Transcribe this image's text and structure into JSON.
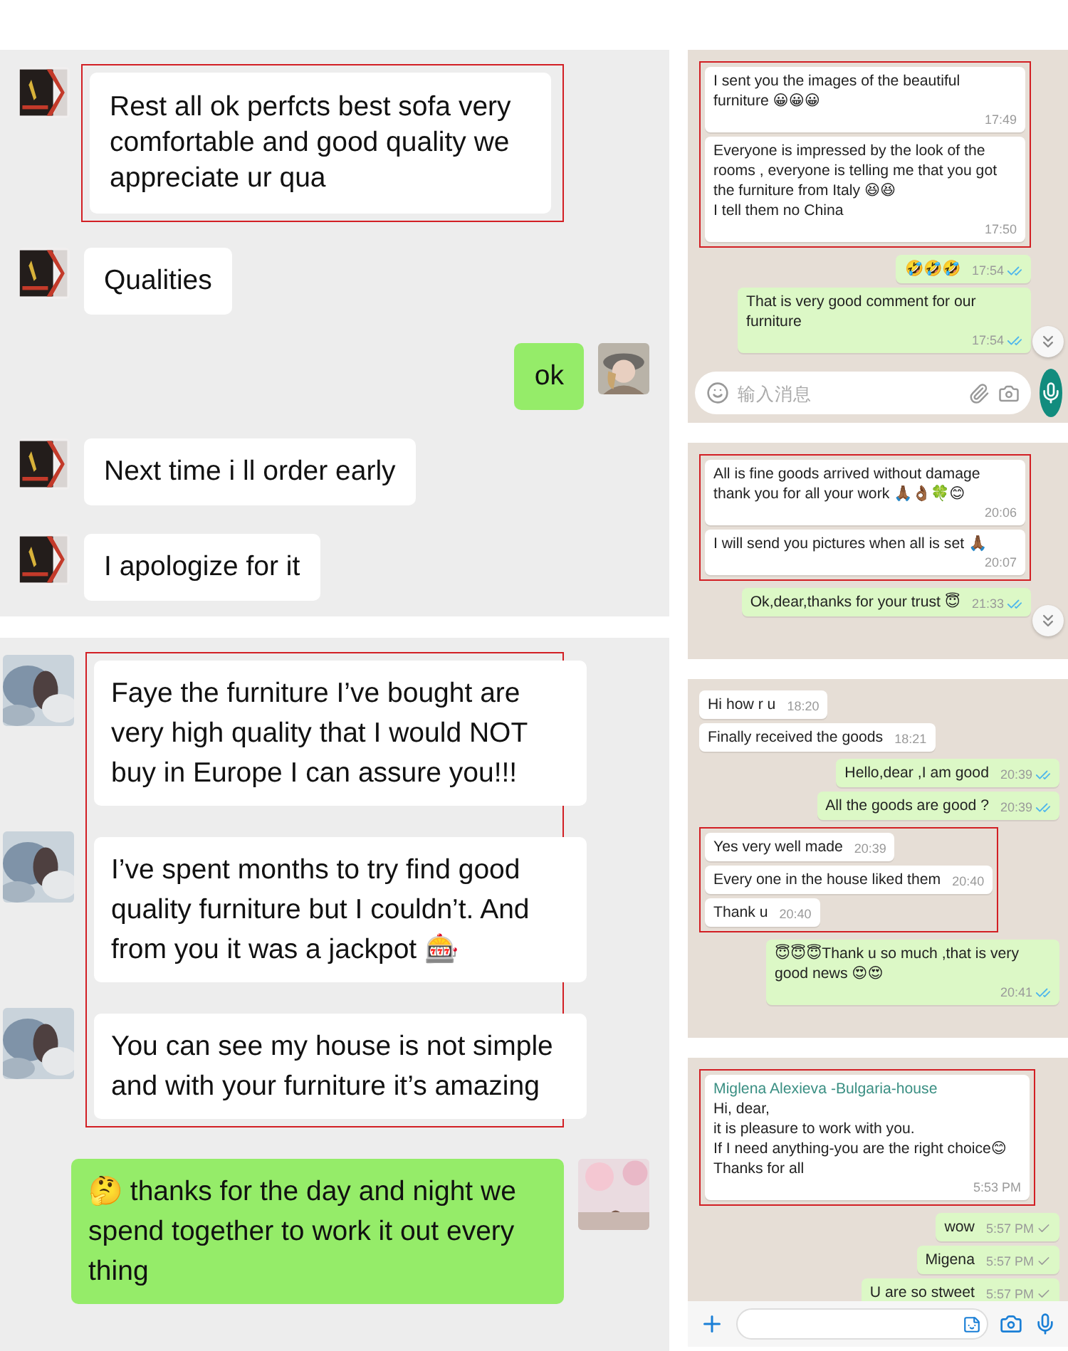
{
  "left_panels": [
    {
      "kind": "wechat",
      "groups": [
        {
          "outgoing": false,
          "highlighted": true,
          "messages": [
            {
              "text": "Rest all ok perfcts best sofa very comfortable and good quality we appreciate ur qua"
            }
          ]
        },
        {
          "outgoing": false,
          "highlighted": false,
          "messages": [
            {
              "text": "Qualities"
            }
          ]
        },
        {
          "outgoing": true,
          "highlighted": false,
          "messages": [
            {
              "text": "ok"
            }
          ]
        },
        {
          "outgoing": false,
          "highlighted": false,
          "messages": [
            {
              "text": "Next time i ll order early"
            }
          ]
        },
        {
          "outgoing": false,
          "highlighted": false,
          "messages": [
            {
              "text": "I apologize for it"
            }
          ]
        }
      ]
    },
    {
      "kind": "wechat_large",
      "groups": [
        {
          "outgoing": false,
          "highlighted": true,
          "messages": [
            {
              "text": "Faye the furniture I’ve bought are very high quality that I would NOT buy in Europe I can assure you!!!"
            },
            {
              "text": "I’ve spent months to try find good quality furniture but I couldn’t. And from you it was a jackpot 🎰"
            },
            {
              "text": "You can see my house is not simple and with your furniture it’s amazing"
            }
          ]
        },
        {
          "outgoing": true,
          "highlighted": false,
          "messages": [
            {
              "text": "🤔 thanks for the day and night we spend together to work it out every thing"
            }
          ]
        }
      ]
    }
  ],
  "right_panels": [
    {
      "kind": "whatsapp",
      "scroll_button": true,
      "groups": [
        {
          "outgoing": false,
          "highlighted": true,
          "messages": [
            {
              "text": "I sent you the images of the beautiful furniture 😀😀😀",
              "time": "17:49"
            },
            {
              "text": "Everyone is impressed by the look of the rooms , everyone is telling me that you got the furniture from Italy 😆😆\nI tell them no China",
              "time": "17:50"
            }
          ]
        },
        {
          "outgoing": true,
          "highlighted": false,
          "messages": [
            {
              "text": "🤣🤣🤣",
              "time": "17:54",
              "read": true
            },
            {
              "text": "That is very good comment for our furniture",
              "time": "17:54",
              "read": true
            }
          ]
        }
      ],
      "input": {
        "kind": "android",
        "placeholder": "输入消息"
      }
    },
    {
      "kind": "whatsapp",
      "scroll_button": true,
      "groups": [
        {
          "outgoing": false,
          "highlighted": true,
          "messages": [
            {
              "text": "All is fine goods arrived without damage thank you for all your work 🙏🏾👌🏾🍀😊",
              "time": "20:06"
            },
            {
              "text": "I will send you pictures when all is set 🙏🏾",
              "time": "20:07"
            }
          ]
        },
        {
          "outgoing": true,
          "highlighted": false,
          "messages": [
            {
              "text": "Ok,dear,thanks for your trust 😇",
              "time": "21:33",
              "read": true
            }
          ]
        }
      ]
    },
    {
      "kind": "whatsapp",
      "groups": [
        {
          "outgoing": false,
          "highlighted": false,
          "messages": [
            {
              "text": "Hi how r u",
              "time": "18:20"
            },
            {
              "text": "Finally received the goods",
              "time": "18:21"
            }
          ]
        },
        {
          "outgoing": true,
          "highlighted": false,
          "messages": [
            {
              "text": "Hello,dear ,I am good",
              "time": "20:39",
              "read": true
            },
            {
              "text": "All the goods are good ?",
              "time": "20:39",
              "read": true
            }
          ]
        },
        {
          "outgoing": false,
          "highlighted": true,
          "messages": [
            {
              "text": "Yes very well made",
              "time": "20:39"
            },
            {
              "text": "Every one in the house liked them",
              "time": "20:40"
            },
            {
              "text": "Thank u",
              "time": "20:40"
            }
          ]
        },
        {
          "outgoing": true,
          "highlighted": false,
          "messages": [
            {
              "text": "😇😇😇Thank u so much ,that is very good news 😍😍",
              "time": "20:41",
              "read": true
            }
          ]
        }
      ]
    },
    {
      "kind": "whatsapp",
      "groups": [
        {
          "outgoing": false,
          "highlighted": true,
          "messages": [
            {
              "sender": "Miglena Alexieva -Bulgaria-house",
              "text": "Hi, dear,\nit is pleasure to work with you.\nIf I need anything-you are the right choice😊\nThanks for all",
              "time": "5:53 PM"
            }
          ]
        },
        {
          "outgoing": true,
          "highlighted": false,
          "messages": [
            {
              "text": "wow",
              "time": "5:57 PM",
              "read": false
            },
            {
              "text": "Migena",
              "time": "5:57 PM",
              "read": false
            },
            {
              "text": "U are so stweet",
              "time": "5:57 PM",
              "read": false
            }
          ]
        }
      ],
      "input": {
        "kind": "ios"
      }
    }
  ]
}
